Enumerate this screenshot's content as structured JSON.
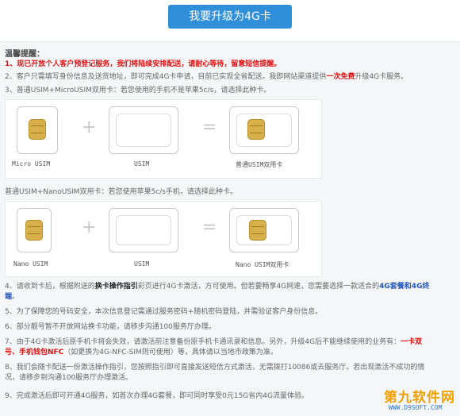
{
  "upgrade_button": "我要升级为4G卡",
  "tips_title": "温馨提醒：",
  "items": {
    "l1_prefix": "1、",
    "l1_red": "现已开放个人客户预登记服务，我们将陆续安排配送，请耐心等待，留意短信提醒。",
    "l2_a": "2、客户只需填写身份信息及送货地址，即可完成4G卡申请，目前已实现全省配送。我即网站渠道提供",
    "l2_red": "一次免费",
    "l2_b": "升级4G卡服务。",
    "l3": "3、普通USIM+MicroUSIM双用卡：若您使用的手机不是苹果5c/s，请选择此种卡。",
    "l3b": "普通USIM+NanoUSIM双用卡：若您使用苹果5c/s手机，请选择此种卡。",
    "l4_a": "4、请收到卡后，根据附送的",
    "l4_dark": "换卡操作指引",
    "l4_b": "彩页进行4G卡激活，方可使用。但若要畅享4G网速，您需要选择一款适合的",
    "l4_blue": "4G套餐和4G终",
    "l4_blue2": "端",
    "l4_end": "。",
    "l5": "5、为了保障您的号码安全，本次信息登记需通过服务密码+随机密码登陆，并需验证客户身份信息。",
    "l6": "6、部分靓号暂不开放网站换卡功能，请移步沟通100服务厅办理。",
    "l7_a": "7、由于4G卡激活后原手机卡将会失效，请激活前注意备份原手机卡通讯录和信息。另外，升级4G后不能继续使用的业务有：",
    "l7_red": "一卡双",
    "l7_red2": "号、手机钱包NFC",
    "l7_b": "（如更换为4G-NFC-SIM则可使用）等，具体请以当地市政策为准。",
    "l8_a": "8、我们会随卡配送一份激活操作指引，您按照指引即可直接发送短信方式激活，无需拨打10086或去服务厅。若出现激活不成功的情",
    "l8_b": "况，请移步到沟通100服务厅办理激活。",
    "l9": "9、完成激活后即可开通4G服务，如首次办理4G套餐，即可同时享受0元15G省内4G流量体验。"
  },
  "sim_row_1": {
    "cap1": "Micro USIM",
    "cap2": "USIM",
    "cap3": "普通USIM双用卡",
    "plus": "+",
    "equals": "="
  },
  "sim_row_2": {
    "cap1": "Nano USIM",
    "cap2": "USIM",
    "cap3": "Nano USIM双用卡",
    "plus": "+",
    "equals": "="
  },
  "logo": {
    "name": "第九软件网",
    "url": "WWW.D9SOFT.COM"
  },
  "colors": {
    "accent": "#2f8fd8",
    "warning": "#e01010",
    "link": "#2255bb",
    "chip": "#d7b04b"
  }
}
